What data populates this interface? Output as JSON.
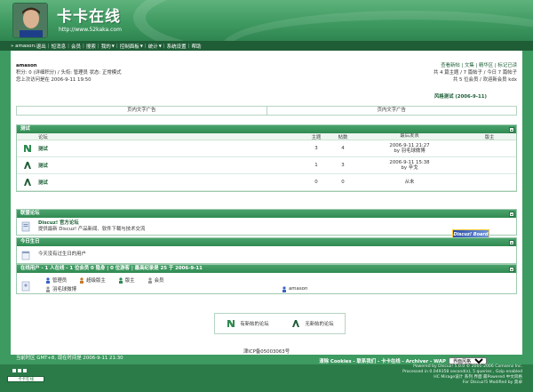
{
  "header": {
    "title": "卡卡在线",
    "url": "http://www.52kaka.com"
  },
  "nav": {
    "items": [
      {
        "label": "» amason:",
        "caret": false
      },
      {
        "label": "退出",
        "caret": false
      },
      {
        "label": "短消息",
        "caret": false
      },
      {
        "label": "会员",
        "caret": false
      },
      {
        "label": "搜索",
        "caret": false
      },
      {
        "label": "我的",
        "caret": true
      },
      {
        "label": "控制面板",
        "caret": true
      },
      {
        "label": "统计",
        "caret": true
      },
      {
        "label": "系统设置",
        "caret": false
      },
      {
        "label": "帮助",
        "caret": false
      }
    ]
  },
  "user": {
    "name": "amason",
    "line1": "积分: 0 (详细积分) / 头衔: 管理员  状态: 正常模式",
    "line2": "您上次访问是在 2006-9-11 19:50"
  },
  "topright": {
    "links": "查看新帖 | 文集 | 精华区 | 标记已读",
    "stats": "共 4 篇主题 / 7 篇帖子 / 今日 7 篇帖子",
    "members": "共 5 位会员 / 欢迎新会员 kdx"
  },
  "lastpost_link": "风格测试 (2006-9-11)",
  "ads": {
    "left": "页内文字广告",
    "right": "页内文字广告"
  },
  "forum_section": {
    "title": "测试",
    "columns": {
      "forum": "论坛",
      "topics": "主题",
      "posts": "帖数",
      "lastpost": "最后发表",
      "mod": "版主"
    },
    "forums": [
      {
        "name": "测试",
        "topics": "3",
        "posts": "4",
        "last_time": "2006-9-11 21:27",
        "last_by": "by 羽毛球微博",
        "mod": "",
        "new": false
      },
      {
        "name": "测试",
        "topics": "1",
        "posts": "3",
        "last_time": "2006-9-11 15:38",
        "last_by": "by 辛戈",
        "mod": "",
        "new": true
      },
      {
        "name": "测试",
        "topics": "0",
        "posts": "0",
        "last_time": "从未",
        "last_by": "",
        "mod": "",
        "new": true
      }
    ]
  },
  "links_section": {
    "title": "联盟论坛",
    "site_name": "Discuz! 官方论坛",
    "site_desc": "提供最新 Discuz! 产品新闻、软件下载与技术交流",
    "logo_text": "Discuz! Board"
  },
  "birthday_section": {
    "title": "今日生日",
    "text": "今天没有过生日的用户"
  },
  "online_section": {
    "title": "在线用户 - 1 人在线 - 1 位会员 0 隐身 | 0 位游客 | 最高纪录是 25 于 2006-9-11",
    "legend": [
      "管理员",
      "超级版主",
      "版主",
      "会员"
    ],
    "users": [
      "羽毛球微博",
      "amason"
    ]
  },
  "buttons": {
    "new_posts": "有新帖的论坛",
    "no_new": "无新帖的论坛"
  },
  "icp": "津ICP备05003063号",
  "footer": {
    "time": "当前时区 GMT+8, 现在时间是 2006-9-11 21:30",
    "links": "清除 Cookies - 联系我们 - 卡卡在线 - Archiver - WAP",
    "style_select": "界面风格",
    "powered1": "Powered by Discuz! 5.0.0 © 2001-2006 Comsenz Inc.",
    "powered2": "Processed in 0.049358 second(s), 5 queries , Gzip enabled",
    "powered3": "HC Mirage设计 系列 界面 最Powered 中文风格",
    "powered4": "For Discuz!5 Modified by 莫卓",
    "taskbox_label": "卡卡在线"
  },
  "colors": {
    "header_green": "#3f9a61",
    "nav_dark": "#1f5d36",
    "link_green": "#1b5e35"
  }
}
